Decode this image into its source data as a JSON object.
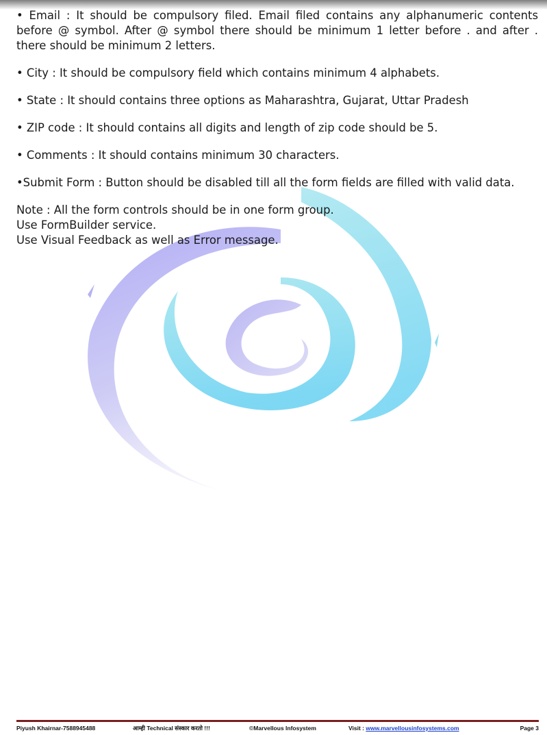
{
  "body": {
    "email": "• Email : It should be compulsory filed. Email filed contains any alphanumeric contents before @ symbol. After @ symbol there should be minimum 1 letter before . and after . there should be minimum 2 letters.",
    "city": "• City : It should be compulsory field which contains minimum 4 alphabets.",
    "state": "• State : It should contains three options as Maharashtra, Gujarat, Uttar Pradesh",
    "zip": "• ZIP code : It should contains all digits and length of zip code should be 5.",
    "comments": "• Comments : It should contains minimum 30 characters.",
    "submit": "•Submit Form : Button should be disabled till all the form fields are filled with valid data.",
    "note_lines": [
      "Note : All the form controls should be in one form group.",
      "Use FormBuilder service.",
      "Use Visual Feedback as well as Error message."
    ]
  },
  "footer": {
    "author": "Piyush Khairnar-7588945488",
    "tagline": "आम्ही Technical संस्कार करतो !!!",
    "copyright": "©Marvellous Infosystem",
    "visit_label": "Visit : ",
    "website": "www.marvellousinfosystems.com",
    "page": "Page 3"
  },
  "colors": {
    "swirl_purple": "#a9a4f4",
    "swirl_cyan": "#7fd8ee",
    "footer_rule": "#7a1f1f",
    "link": "#1a3fcc"
  }
}
